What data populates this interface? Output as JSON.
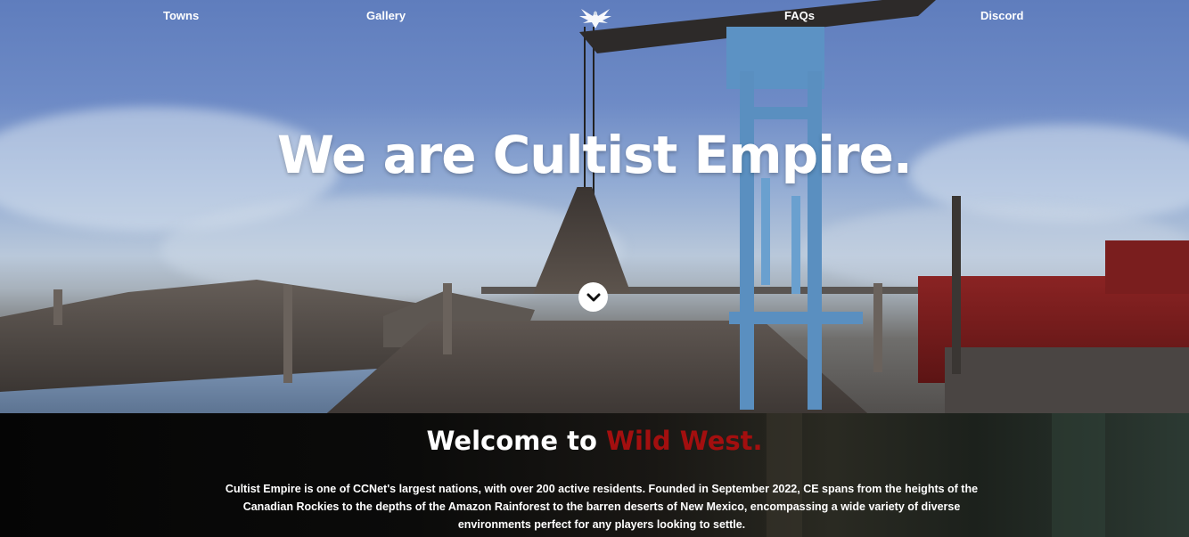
{
  "nav": {
    "items": [
      {
        "label": "Towns"
      },
      {
        "label": "Gallery"
      },
      {
        "label": "FAQs"
      },
      {
        "label": "Discord"
      }
    ],
    "logo_icon": "winged-emblem-icon"
  },
  "hero": {
    "title": "We are Cultist Empire.",
    "scroll_icon": "chevron-down-icon"
  },
  "welcome": {
    "title_prefix": "Welcome to ",
    "title_accent": "Wild West.",
    "body": "Cultist Empire is one of CCNet's largest nations, with over 200 active residents. Founded in September 2022, CE spans from the heights of the Canadian Rockies to the depths of the Amazon Rainforest to the barren deserts of New Mexico, encompassing a wide variety of diverse environments perfect for any players looking to settle."
  },
  "colors": {
    "accent": "#a30f0f",
    "nav_text": "#ffffff",
    "crane_blue": "#5a8fc0"
  }
}
